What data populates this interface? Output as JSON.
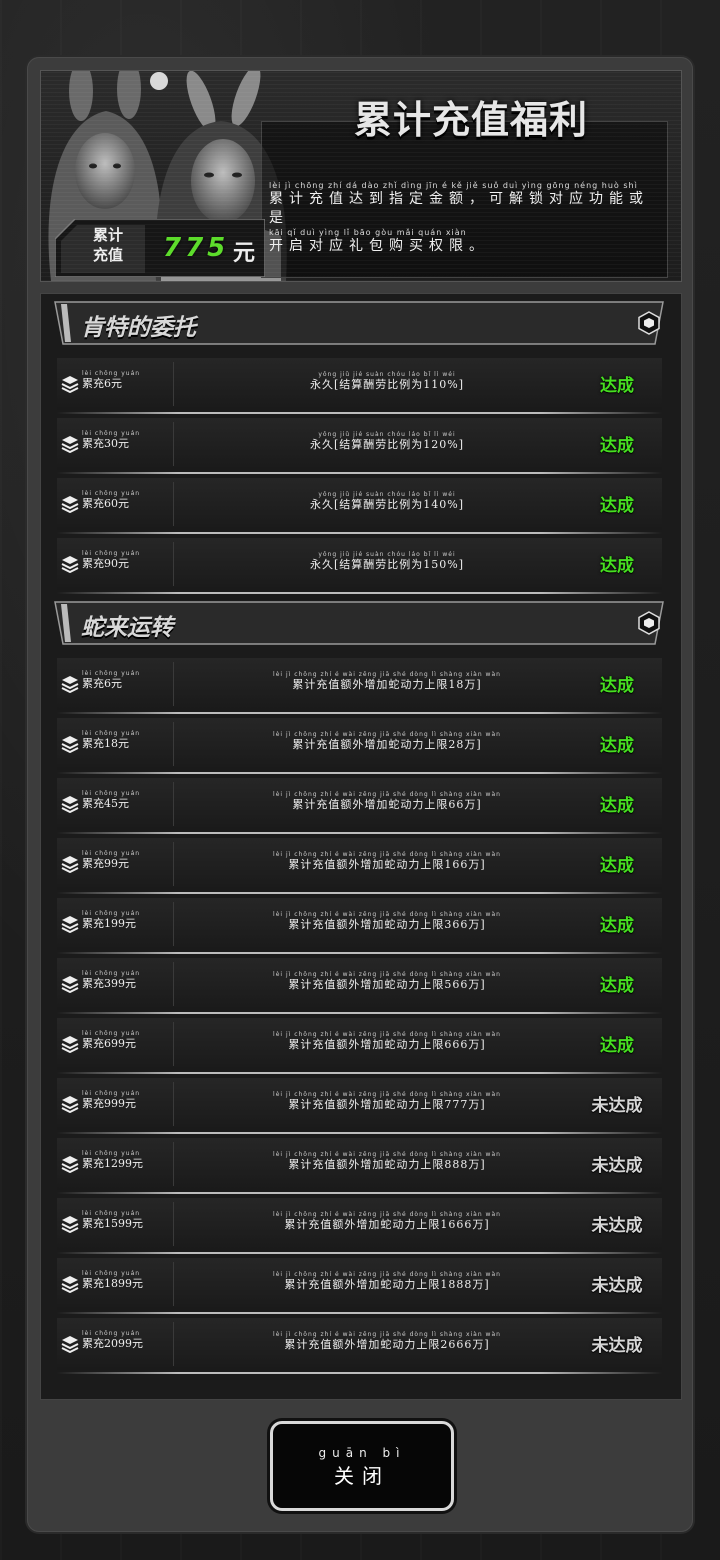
{
  "header": {
    "title": "累计充值福利",
    "description_pinyin_1": "lèi jì chōng zhí dá dào zhǐ dìng jīn é kě jiě suǒ duì yìng gōng néng huò shì",
    "description_line_1": "累计充值达到指定金额，可解锁对应功能或是",
    "description_pinyin_2": "kāi qǐ duì yìng lǐ bāo gòu mǎi quán xiàn",
    "description_line_2": "开启对应礼包购买权限。",
    "total_label_1": "累计",
    "total_label_2": "充值",
    "total_value": "775",
    "total_unit": "元"
  },
  "sections": [
    {
      "title": "肯特的委托",
      "rows": [
        {
          "req_py": "lèi chōng yuán",
          "req": "累充6元",
          "rew_py": "yǒng jiǔ jié suàn chóu láo bǐ lì wéi",
          "rew": "永久[结算酬劳比例为110%]",
          "status": "达成"
        },
        {
          "req_py": "lèi chōng yuán",
          "req": "累充30元",
          "rew_py": "yǒng jiǔ jié suàn chóu láo bǐ lì wéi",
          "rew": "永久[结算酬劳比例为120%]",
          "status": "达成"
        },
        {
          "req_py": "lèi chōng yuán",
          "req": "累充60元",
          "rew_py": "yǒng jiǔ jié suàn chóu láo bǐ lì wéi",
          "rew": "永久[结算酬劳比例为140%]",
          "status": "达成"
        },
        {
          "req_py": "lèi chōng yuán",
          "req": "累充90元",
          "rew_py": "yǒng jiǔ jié suàn chóu láo bǐ lì wéi",
          "rew": "永久[结算酬劳比例为150%]",
          "status": "达成"
        }
      ]
    },
    {
      "title": "蛇来运转",
      "rows": [
        {
          "req_py": "lèi chōng yuán",
          "req": "累充6元",
          "rew_py": "lèi jì chōng zhí é wài zēng jiā shé dòng lì shàng xiàn wàn",
          "rew": "累计充值额外增加蛇动力上限18万]",
          "status": "达成"
        },
        {
          "req_py": "lèi chōng yuán",
          "req": "累充18元",
          "rew_py": "lèi jì chōng zhí é wài zēng jiā shé dòng lì shàng xiàn wàn",
          "rew": "累计充值额外增加蛇动力上限28万]",
          "status": "达成"
        },
        {
          "req_py": "lèi chōng yuán",
          "req": "累充45元",
          "rew_py": "lèi jì chōng zhí é wài zēng jiā shé dòng lì shàng xiàn wàn",
          "rew": "累计充值额外增加蛇动力上限66万]",
          "status": "达成"
        },
        {
          "req_py": "lèi chōng yuán",
          "req": "累充99元",
          "rew_py": "lèi jì chōng zhí é wài zēng jiā shé dòng lì shàng xiàn wàn",
          "rew": "累计充值额外增加蛇动力上限166万]",
          "status": "达成"
        },
        {
          "req_py": "lèi chōng yuán",
          "req": "累充199元",
          "rew_py": "lèi jì chōng zhí é wài zēng jiā shé dòng lì shàng xiàn wàn",
          "rew": "累计充值额外增加蛇动力上限366万]",
          "status": "达成"
        },
        {
          "req_py": "lèi chōng yuán",
          "req": "累充399元",
          "rew_py": "lèi jì chōng zhí é wài zēng jiā shé dòng lì shàng xiàn wàn",
          "rew": "累计充值额外增加蛇动力上限566万]",
          "status": "达成"
        },
        {
          "req_py": "lèi chōng yuán",
          "req": "累充699元",
          "rew_py": "lèi jì chōng zhí é wài zēng jiā shé dòng lì shàng xiàn wàn",
          "rew": "累计充值额外增加蛇动力上限666万]",
          "status": "达成"
        },
        {
          "req_py": "lèi chōng yuán",
          "req": "累充999元",
          "rew_py": "lèi jì chōng zhí é wài zēng jiā shé dòng lì shàng xiàn wàn",
          "rew": "累计充值额外增加蛇动力上限777万]",
          "status": "未达成"
        },
        {
          "req_py": "lèi chōng yuán",
          "req": "累充1299元",
          "rew_py": "lèi jì chōng zhí é wài zēng jiā shé dòng lì shàng xiàn wàn",
          "rew": "累计充值额外增加蛇动力上限888万]",
          "status": "未达成"
        },
        {
          "req_py": "lèi chōng yuán",
          "req": "累充1599元",
          "rew_py": "lèi jì chōng zhí é wài zēng jiā shé dòng lì shàng xiàn wàn",
          "rew": "累计充值额外增加蛇动力上限1666万]",
          "status": "未达成"
        },
        {
          "req_py": "lèi chōng yuán",
          "req": "累充1899元",
          "rew_py": "lèi jì chōng zhí é wài zēng jiā shé dòng lì shàng xiàn wàn",
          "rew": "累计充值额外增加蛇动力上限1888万]",
          "status": "未达成"
        },
        {
          "req_py": "lèi chōng yuán",
          "req": "累充2099元",
          "rew_py": "lèi jì chōng zhí é wài zēng jiā shé dòng lì shàng xiàn wàn",
          "rew": "累计充值额外增加蛇动力上限2666万]",
          "status": "未达成"
        }
      ]
    }
  ],
  "close": {
    "pinyin": "guān bì",
    "label": "关闭"
  },
  "colors": {
    "achieved": "#46e020",
    "not_achieved": "#d6d6d6",
    "total_value": "#5cdc2a"
  },
  "icons": {
    "row": "stack-layers-icon",
    "section": "hexagon-icon"
  }
}
